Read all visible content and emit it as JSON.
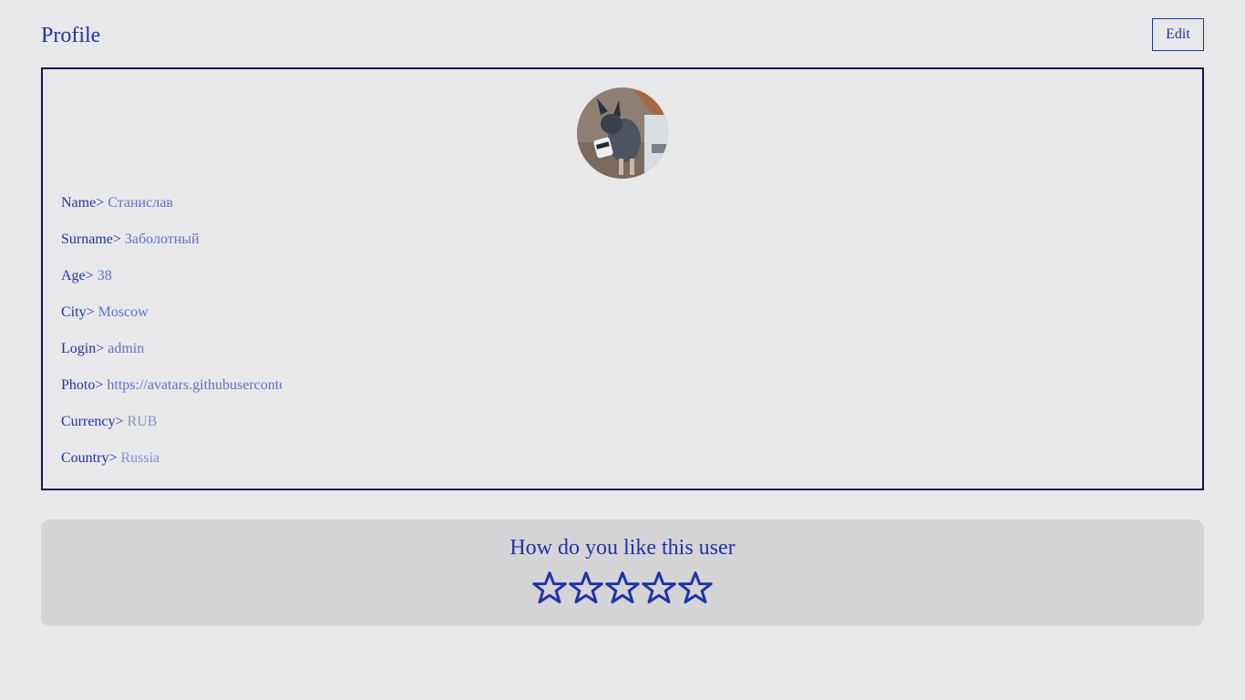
{
  "header": {
    "title": "Profile",
    "edit_label": "Edit"
  },
  "profile": {
    "avatar_icon": "dog-photo",
    "fields": [
      {
        "label": "Name>",
        "value": "Станислав"
      },
      {
        "label": "Surname>",
        "value": "Заболотный"
      },
      {
        "label": "Age>",
        "value": "38"
      },
      {
        "label": "City>",
        "value": "Moscow"
      },
      {
        "label": "Login>",
        "value": "admin"
      },
      {
        "label": "Photo>",
        "value": "https://avatars.githubusercontent.com"
      },
      {
        "label": "Currency>",
        "value": "RUB"
      },
      {
        "label": "Country>",
        "value": "Russia"
      }
    ]
  },
  "rating": {
    "title": "How do you like this user",
    "icon": "star-outline-icon",
    "max_stars": 5,
    "current_rating": 0
  },
  "colors": {
    "accent": "#1f33a8",
    "value_text": "#5c74c9",
    "muted_value_text": "#8793c6",
    "background": "#e8e8eb",
    "panel": "#d4d4d7",
    "card_border": "#0f1654"
  }
}
